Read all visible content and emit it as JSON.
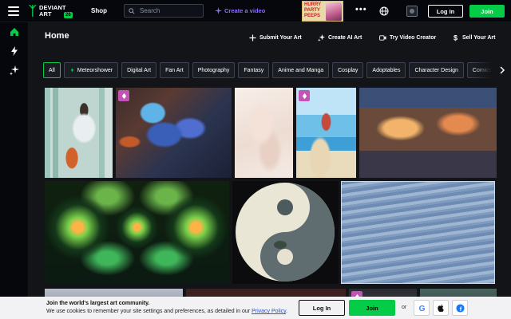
{
  "header": {
    "logo_lines": [
      "DEVIANT",
      "ART"
    ],
    "logo_badge": "26",
    "shop_label": "Shop",
    "search_placeholder": "Search",
    "create_video_label": "Create a video",
    "ad_text": "HURRY PARTY PEEPS",
    "login_label": "Log In",
    "join_label": "Join",
    "accent_color": "#05cc47"
  },
  "sidebar": {
    "items": [
      {
        "icon": "home-icon"
      },
      {
        "icon": "bolt-icon"
      },
      {
        "icon": "sparkle-icon"
      }
    ]
  },
  "main": {
    "title": "Home",
    "actions": [
      {
        "label": "Submit Your Art",
        "icon": "plus-icon"
      },
      {
        "label": "Create AI Art",
        "icon": "ai-sparkle-icon"
      },
      {
        "label": "Try Video Creator",
        "icon": "video-icon"
      },
      {
        "label": "Sell Your Art",
        "icon": "dollar-icon"
      }
    ],
    "chips": [
      "All",
      "Meteorshower",
      "Digital Art",
      "Fan Art",
      "Photography",
      "Fantasy",
      "Anime and Manga",
      "Cosplay",
      "Adoptables",
      "Character Design",
      "Comics"
    ]
  },
  "gallery": [
    {
      "name": "fox-girl-winter",
      "core": false
    },
    {
      "name": "blue-hair-character",
      "core": true
    },
    {
      "name": "pastel-sketch",
      "core": false
    },
    {
      "name": "anime-beach",
      "core": true
    },
    {
      "name": "tokyo-street-night",
      "core": false
    },
    {
      "name": "green-fractal",
      "core": false
    },
    {
      "name": "yin-yang-painting",
      "core": false
    },
    {
      "name": "water-ripples",
      "core": false
    }
  ],
  "cookie": {
    "heading": "Join the world's largest art community.",
    "text": "We use cookies to remember your site settings and preferences, as detailed in our",
    "link": "Privacy Policy",
    "end": ".",
    "login_label": "Log In",
    "join_label": "Join",
    "or_label": "or"
  }
}
